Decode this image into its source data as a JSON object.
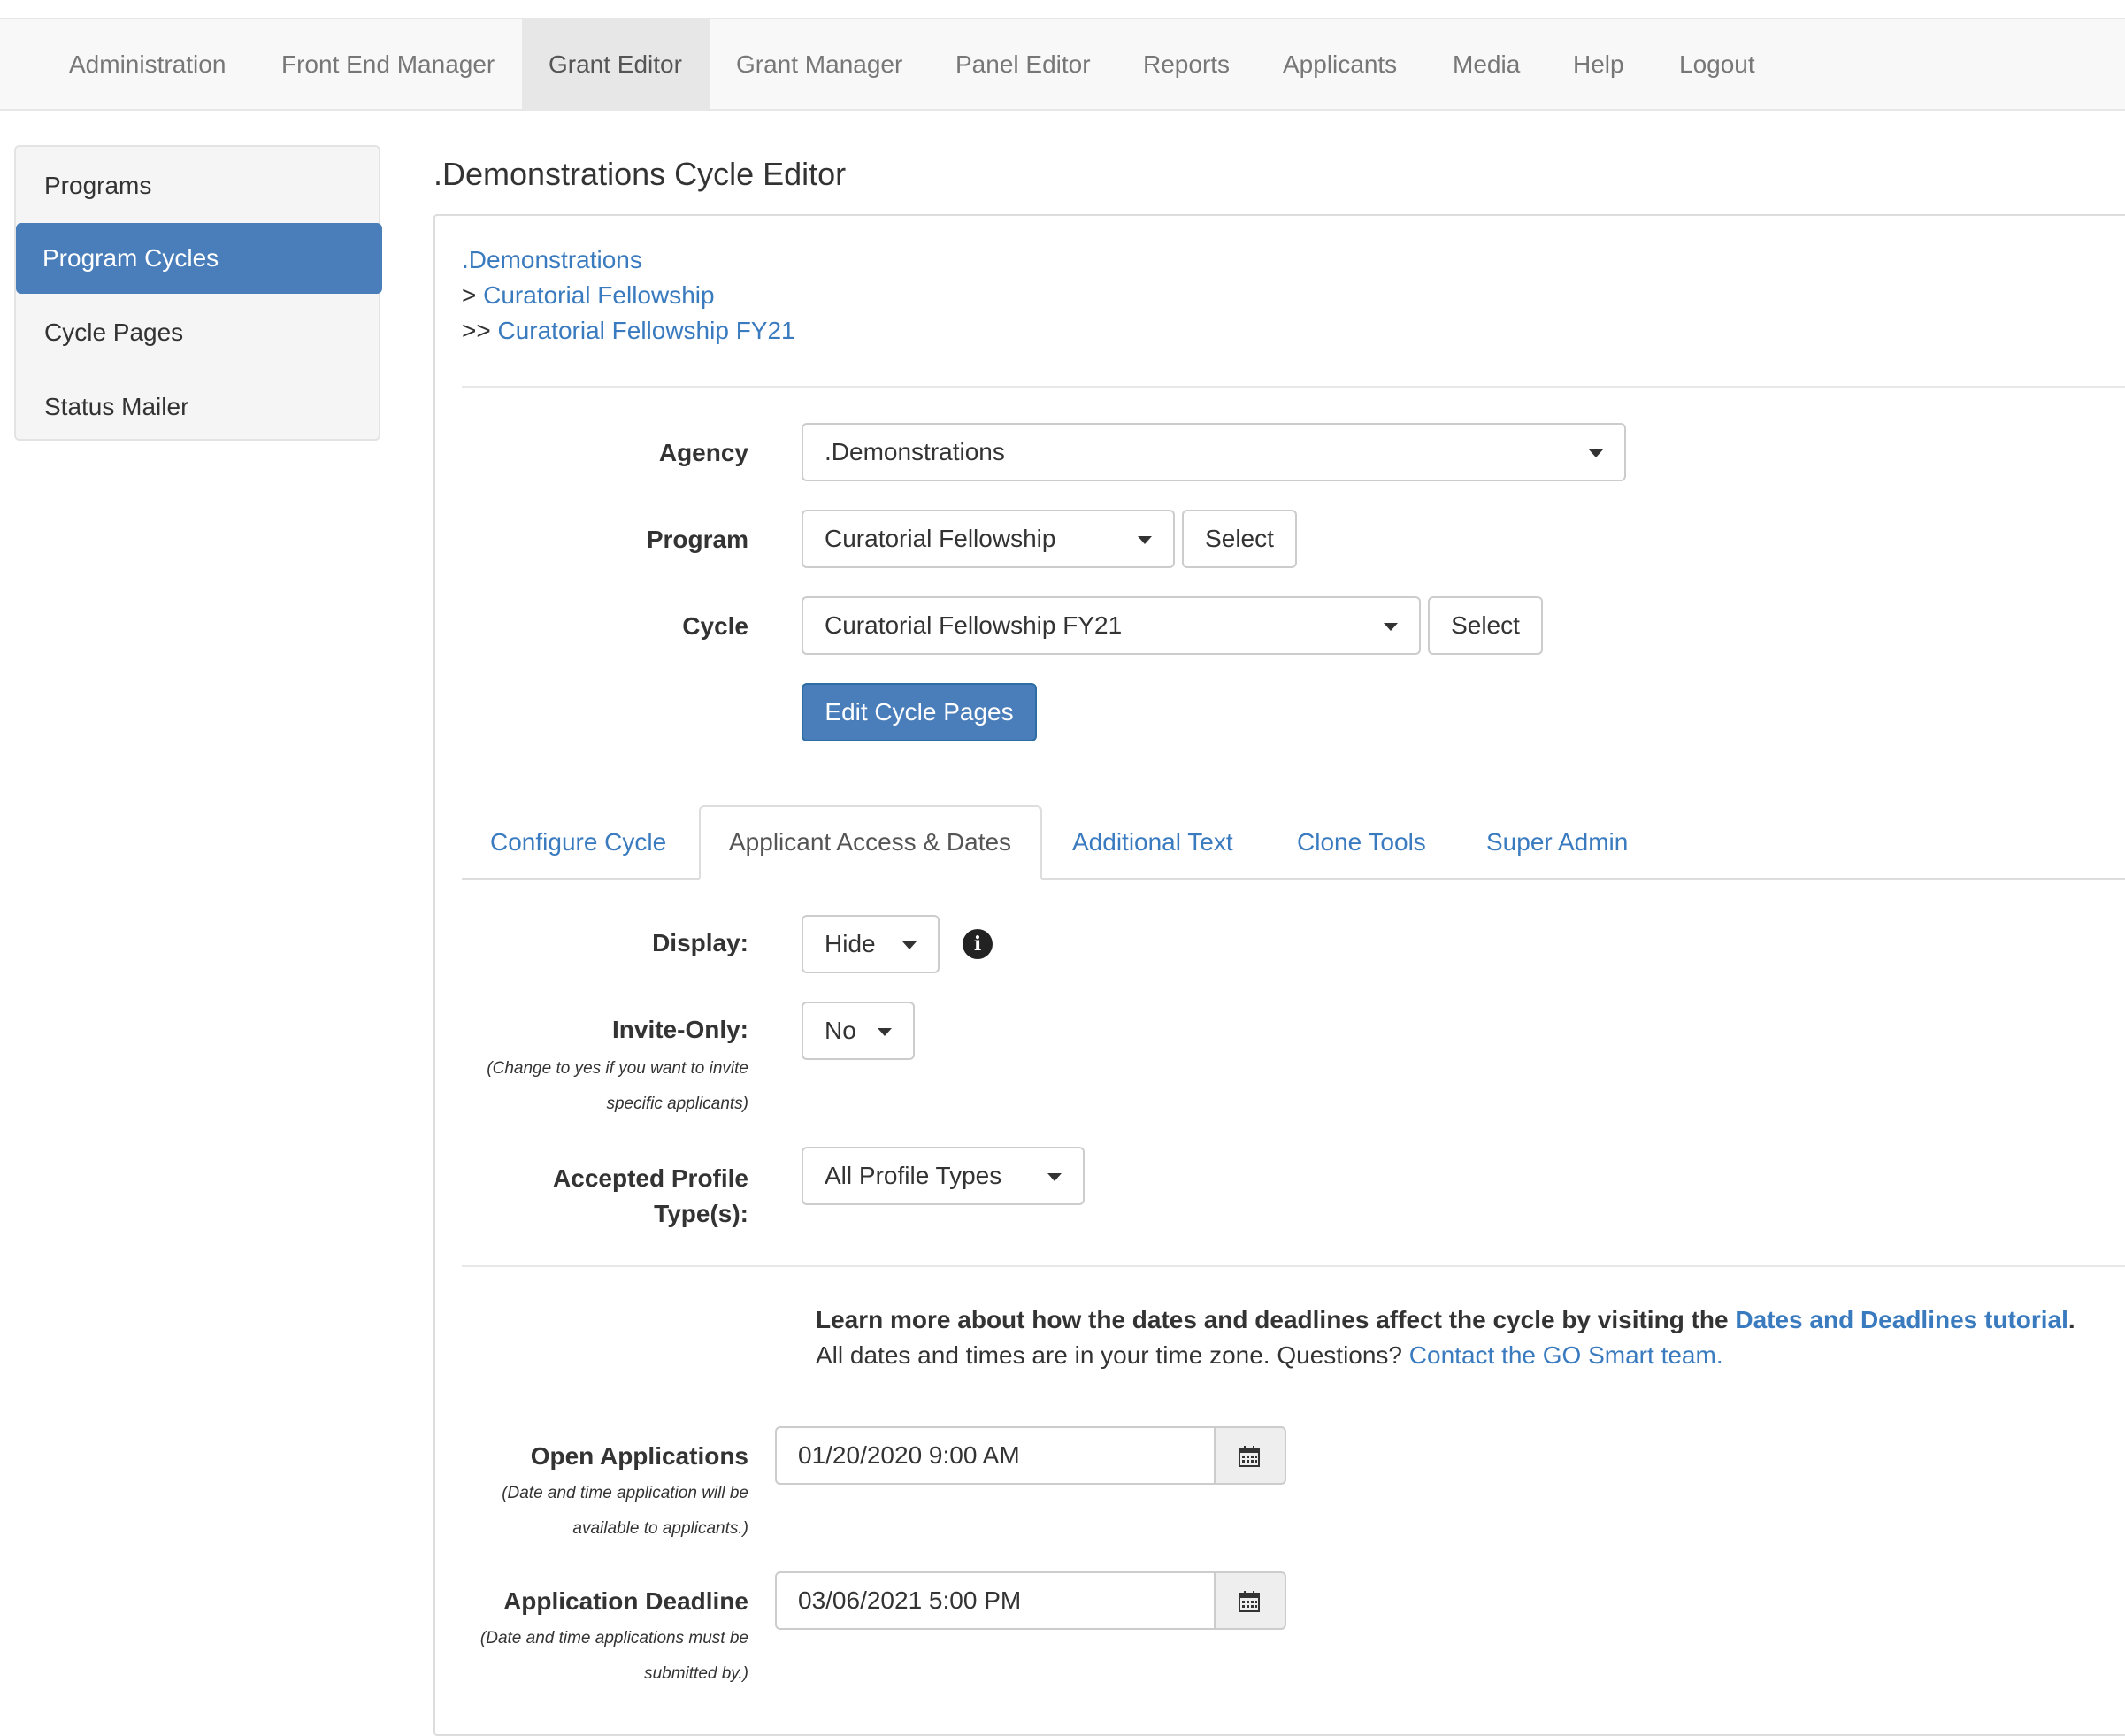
{
  "nav": {
    "items": [
      {
        "label": "Administration"
      },
      {
        "label": "Front End Manager"
      },
      {
        "label": "Grant Editor"
      },
      {
        "label": "Grant Manager"
      },
      {
        "label": "Panel Editor"
      },
      {
        "label": "Reports"
      },
      {
        "label": "Applicants"
      },
      {
        "label": "Media"
      },
      {
        "label": "Help"
      },
      {
        "label": "Logout"
      }
    ],
    "active": "Grant Editor"
  },
  "sidebar": {
    "items": [
      {
        "label": "Programs"
      },
      {
        "label": "Program Cycles"
      },
      {
        "label": "Cycle Pages"
      },
      {
        "label": "Status Mailer"
      }
    ],
    "active": "Program Cycles"
  },
  "page": {
    "title": ".Demonstrations Cycle Editor"
  },
  "breadcrumb": {
    "level1": ".Demonstrations",
    "level2_prefix": ">",
    "level2": "Curatorial Fellowship",
    "level3_prefix": ">>",
    "level3": "Curatorial Fellowship FY21"
  },
  "selectors": {
    "agency_label": "Agency",
    "agency_value": ".Demonstrations",
    "program_label": "Program",
    "program_value": "Curatorial Fellowship",
    "program_select_button": "Select",
    "cycle_label": "Cycle",
    "cycle_value": "Curatorial Fellowship FY21",
    "cycle_select_button": "Select",
    "edit_pages_button": "Edit Cycle Pages"
  },
  "tabs": [
    {
      "label": "Configure Cycle"
    },
    {
      "label": "Applicant Access & Dates"
    },
    {
      "label": "Additional Text"
    },
    {
      "label": "Clone Tools"
    },
    {
      "label": "Super Admin"
    }
  ],
  "active_tab": "Applicant Access & Dates",
  "access": {
    "display_label": "Display:",
    "display_value": "Hide",
    "invite_label": "Invite-Only:",
    "invite_help_1": "(Change to yes if you want to invite",
    "invite_help_2": "specific applicants)",
    "invite_value": "No",
    "profile_label_1": "Accepted Profile",
    "profile_label_2": "Type(s):",
    "profile_value": "All Profile Types"
  },
  "dates_note": {
    "line1_text": "Learn more about how the dates and deadlines affect the cycle by visiting the ",
    "line1_link": "Dates and Deadlines tutorial",
    "line1_end": ".",
    "line2_text": "All dates and times are in your time zone. Questions? ",
    "line2_link": "Contact the GO Smart team."
  },
  "dates": {
    "open_label": "Open Applications",
    "open_help_1": "(Date and time application will be",
    "open_help_2": "available to applicants.)",
    "open_value": "01/20/2020 9:00 AM",
    "deadline_label": "Application Deadline",
    "deadline_help_1": "(Date and time applications must be",
    "deadline_help_2": "submitted by.)",
    "deadline_value": "03/06/2021 5:00 PM"
  },
  "colors": {
    "primary": "#4a7ebb",
    "link": "#3a7bbf",
    "nav_bg": "#f8f8f8"
  },
  "icons": [
    "caret-down-icon",
    "info-circle-icon",
    "calendar-icon"
  ]
}
